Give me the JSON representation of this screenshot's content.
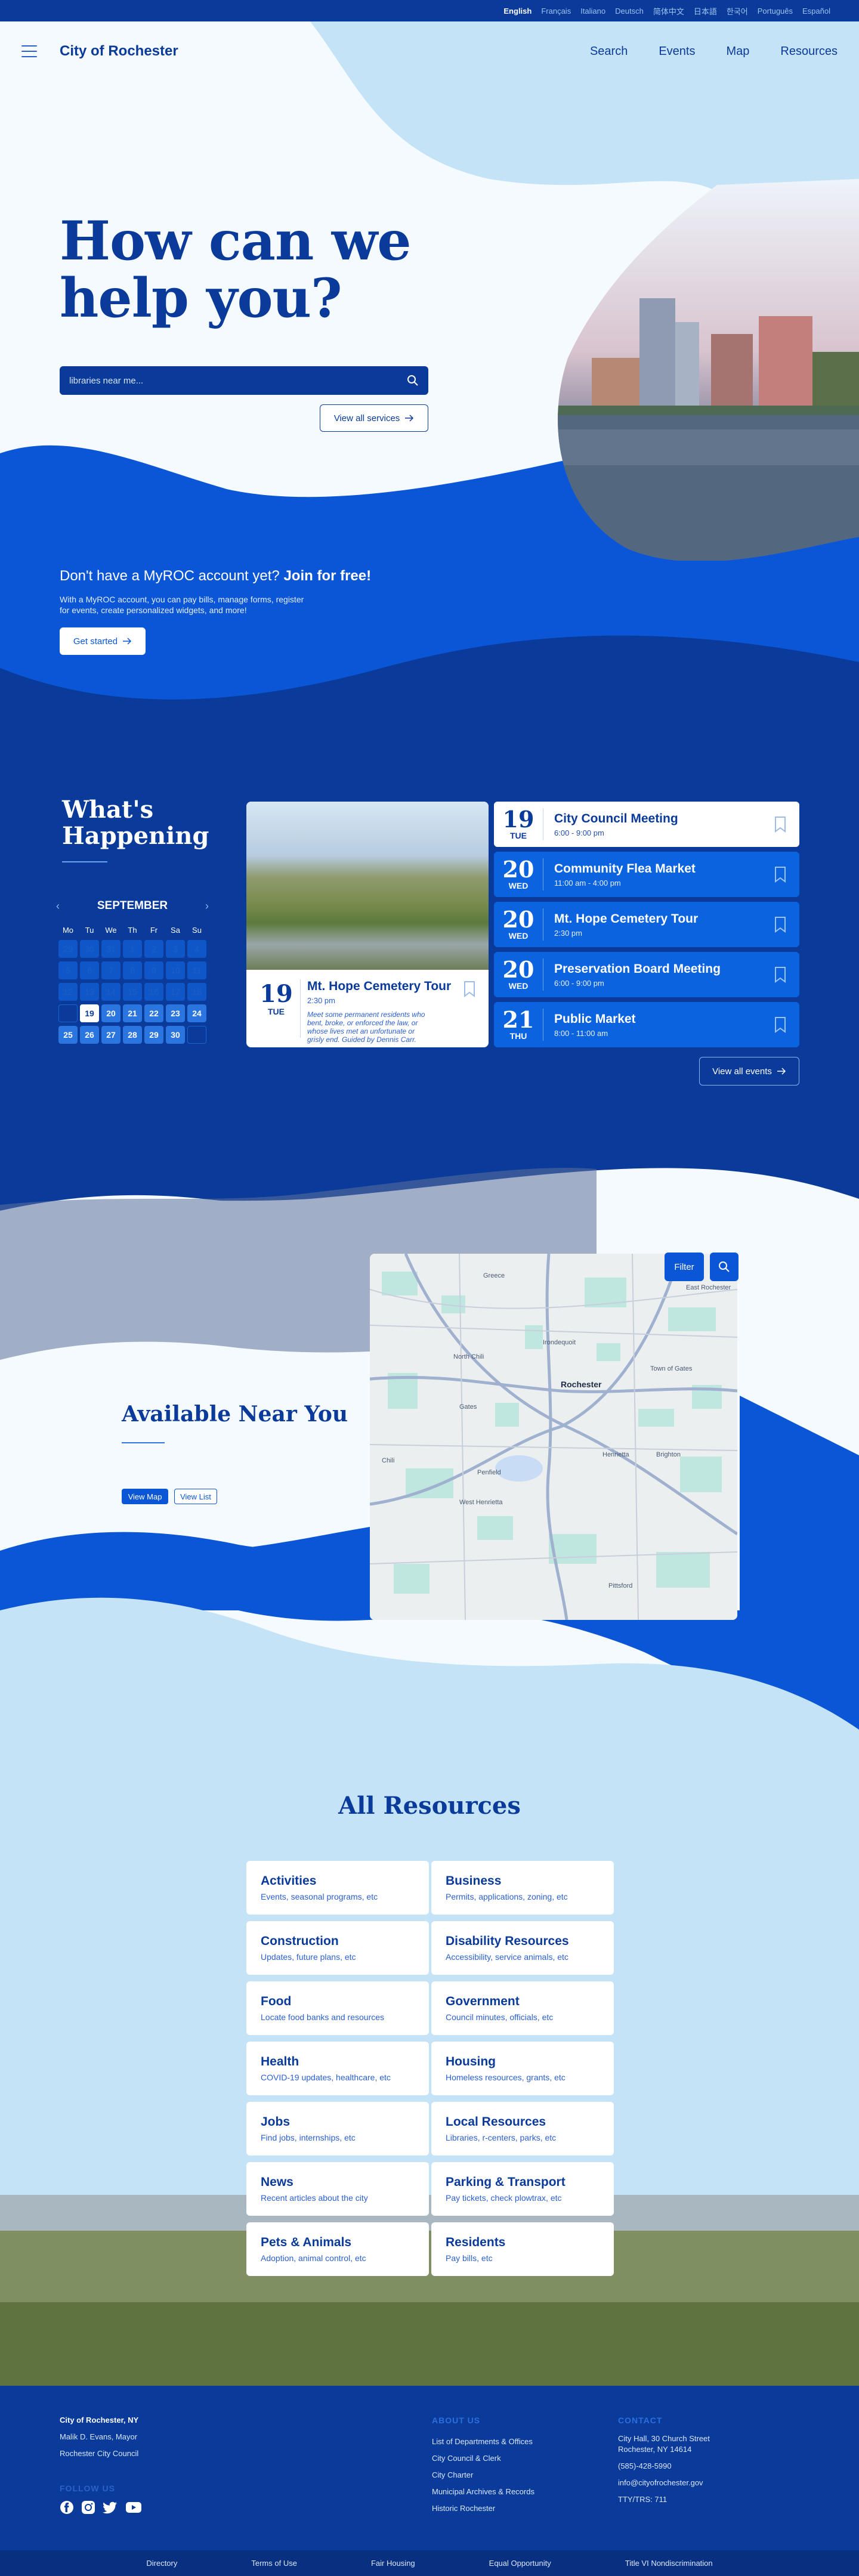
{
  "languages": [
    "English",
    "Français",
    "Italiano",
    "Deutsch",
    "简体中文",
    "日本語",
    "한국어",
    "Português",
    "Español"
  ],
  "header": {
    "brand": "City of Rochester",
    "nav": [
      "Search",
      "Events",
      "Map",
      "Resources"
    ]
  },
  "hero": {
    "title_line1": "How can we",
    "title_line2": "help you?",
    "search_placeholder": "libraries near me...",
    "view_all_services": "View all services"
  },
  "promo": {
    "question": "Don't have a MyROC account yet?",
    "cta_bold": "Join for free!",
    "description": "With a MyROC account, you can pay bills, manage forms, register for events, create personalized widgets, and more!",
    "button": "Get started"
  },
  "events": {
    "title_line1": "What's",
    "title_line2": "Happening",
    "month": "SEPTEMBER",
    "dow": [
      "Mo",
      "Tu",
      "We",
      "Th",
      "Fr",
      "Sa",
      "Su"
    ],
    "featured": {
      "day": "19",
      "weekday": "TUE",
      "title": "Mt. Hope Cemetery Tour",
      "time": "2:30 pm",
      "description": "Meet some permanent residents who bent, broke, or enforced the law, or whose lives met an unfortunate or grisly end. Guided by Dennis Carr."
    },
    "list": [
      {
        "day": "19",
        "weekday": "TUE",
        "title": "City Council Meeting",
        "time": "6:00 - 9:00 pm"
      },
      {
        "day": "20",
        "weekday": "WED",
        "title": "Community Flea Market",
        "time": "11:00 am - 4:00 pm"
      },
      {
        "day": "20",
        "weekday": "WED",
        "title": "Mt. Hope Cemetery Tour",
        "time": "2:30 pm"
      },
      {
        "day": "20",
        "weekday": "WED",
        "title": "Preservation Board Meeting",
        "time": "6:00 - 9:00 pm"
      },
      {
        "day": "21",
        "weekday": "THU",
        "title": "Public Market",
        "time": "8:00 - 11:00 am"
      }
    ],
    "view_all": "View all events"
  },
  "nearby": {
    "title": "Available Near You",
    "view_map": "View Map",
    "view_list": "View List",
    "filter": "Filter",
    "map_labels": {
      "greece": "Greece",
      "irondequoit": "Irondequoit",
      "rochester": "Rochester",
      "gates": "Gates",
      "brighton": "Brighton",
      "chili": "Chili",
      "henrietta": "Henrietta",
      "pittsford": "Pittsford",
      "east_rochester": "East Rochester",
      "north_chili": "North Chili",
      "town_of_gates": "Town of Gates",
      "penfield": "Penfield",
      "west_henrietta": "West Henrietta"
    }
  },
  "resources": {
    "title": "All Resources",
    "items": [
      {
        "title": "Activities",
        "sub": "Events, seasonal programs, etc"
      },
      {
        "title": "Business",
        "sub": "Permits, applications, zoning, etc"
      },
      {
        "title": "Construction",
        "sub": "Updates, future plans, etc"
      },
      {
        "title": "Disability Resources",
        "sub": "Accessibility, service animals, etc"
      },
      {
        "title": "Food",
        "sub": "Locate food banks and resources"
      },
      {
        "title": "Government",
        "sub": "Council minutes, officials, etc"
      },
      {
        "title": "Health",
        "sub": "COVID-19 updates, healthcare, etc"
      },
      {
        "title": "Housing",
        "sub": "Homeless resources, grants, etc"
      },
      {
        "title": "Jobs",
        "sub": "Find jobs, internships, etc"
      },
      {
        "title": "Local Resources",
        "sub": "Libraries, r-centers, parks, etc"
      },
      {
        "title": "News",
        "sub": "Recent articles about the city"
      },
      {
        "title": "Parking & Transport",
        "sub": "Pay tickets, check plowtrax, etc"
      },
      {
        "title": "Pets & Animals",
        "sub": "Adoption, animal control, etc"
      },
      {
        "title": "Residents",
        "sub": "Pay bills, etc"
      }
    ]
  },
  "footer": {
    "org": "City of Rochester, NY",
    "mayor": "Malik D. Evans, Mayor",
    "council": "Rochester City Council",
    "follow": "FOLLOW US",
    "about_head": "ABOUT US",
    "about": [
      "List of Departments & Offices",
      "City Council & Clerk",
      "City Charter",
      "Municipal Archives & Records",
      "Historic Rochester"
    ],
    "contact_head": "CONTACT",
    "contact": [
      "City Hall, 30 Church Street",
      "Rochester, NY 14614",
      "(585)-428-5990",
      "info@cityofrochester.gov",
      "TTY/TRS: 711"
    ],
    "bottom": [
      "Directory",
      "Terms of Use",
      "Fair Housing",
      "Equal Opportunity",
      "Title VI Nondiscrimination"
    ]
  },
  "colors": {
    "navy": "#0a3a9a",
    "blue": "#0a56d6",
    "light": "#c4e3f6"
  }
}
